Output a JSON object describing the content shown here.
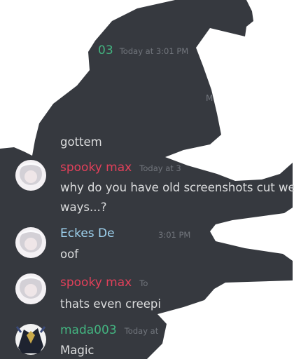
{
  "colors": {
    "chat_bg": "#36393f",
    "spooky_name": "#e2405a",
    "ecke_name": "#9fd3f0",
    "mada_name": "#43b581",
    "message_text": "#dcddde",
    "timestamp": "#72767d"
  },
  "chat": {
    "fragments": {
      "top_timestamp": "03  Today at 3:01 PM",
      "mid_fragment": "M",
      "gottem": "gottem"
    },
    "messages": [
      {
        "author": "spooky max",
        "timestamp": "Today at 3",
        "text_line1": "why do you have old screenshots cut weir",
        "text_line2": "ways...?",
        "avatar_icon": "white-hair-anime-avatar-icon"
      },
      {
        "author": "Eckes De",
        "timestamp": "3:01 PM",
        "text_line1": "oof",
        "avatar_icon": "white-hair-anime-avatar-icon"
      },
      {
        "author": "spooky max",
        "timestamp": "To",
        "text_line1": "thats even creepi",
        "avatar_icon": "white-hair-anime-avatar-icon"
      },
      {
        "author": "mada003",
        "timestamp": "Today at",
        "text_line1": "Magic",
        "avatar_icon": "armored-knight-avatar-icon"
      }
    ]
  }
}
